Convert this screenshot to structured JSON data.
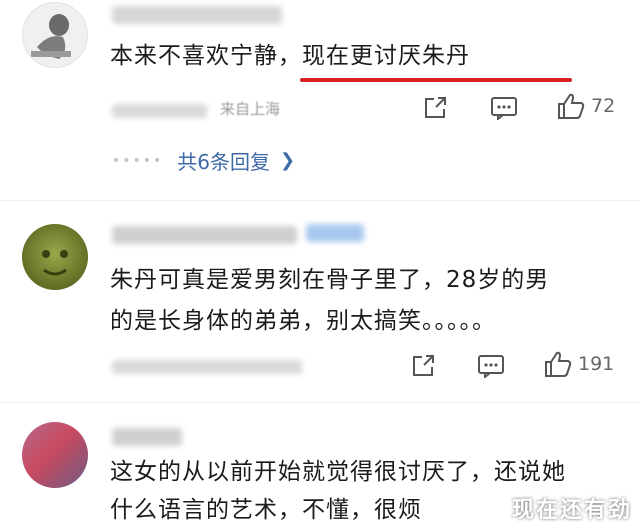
{
  "comments": [
    {
      "text": "本来不喜欢宁静，现在更讨厌朱丹",
      "location": "来自上海",
      "likes": "72",
      "replies_label": "共6条回复"
    },
    {
      "line1": "朱丹可真是爱男刻在骨子里了，28岁的男",
      "line2": "的是长身体的弟弟，别太搞笑。。。。。",
      "likes": "191"
    },
    {
      "line1": "这女的从以前开始就觉得很讨厌了，还说她",
      "line2": "什么语言的艺术，不懂，很烦"
    }
  ],
  "watermark": "现在还有劲",
  "colors": {
    "underline": "#d82020",
    "reply_link": "#3f6aa8"
  }
}
